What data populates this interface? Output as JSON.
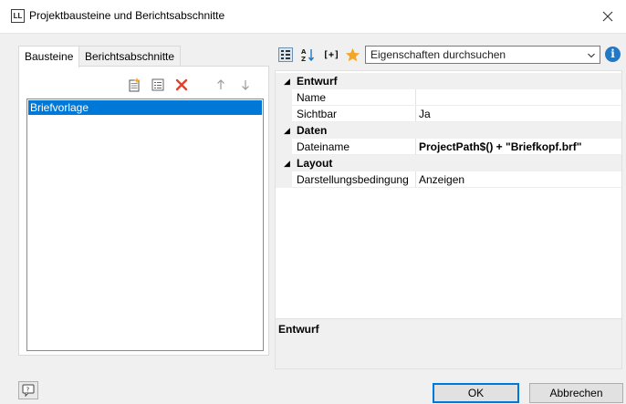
{
  "window": {
    "app_icon_text": "LL",
    "title": "Projektbausteine und Berichtsabschnitte"
  },
  "left": {
    "tabs": [
      {
        "label": "Bausteine",
        "active": true
      },
      {
        "label": "Berichtsabschnitte",
        "active": false
      }
    ],
    "toolbar_icons": [
      "new-item-icon",
      "properties-icon",
      "delete-icon",
      "move-up-icon",
      "move-down-icon"
    ],
    "list_items": [
      {
        "label": "Briefvorlage",
        "selected": true
      }
    ]
  },
  "right": {
    "toolbar_icons": [
      "categorized-view-icon",
      "sort-alphabetical-icon",
      "expand-formula-icon",
      "favorites-star-icon"
    ],
    "expand_label": "[+]",
    "search": {
      "placeholder": "Eigenschaften durchsuchen"
    },
    "info_label": "i",
    "categories": [
      {
        "label": "Entwurf",
        "properties": [
          {
            "name": "Name",
            "value": ""
          },
          {
            "name": "Sichtbar",
            "value": "Ja"
          }
        ]
      },
      {
        "label": "Daten",
        "properties": [
          {
            "name": "Dateiname",
            "value": "ProjectPath$() + \"Briefkopf.brf\"",
            "bold": true
          }
        ]
      },
      {
        "label": "Layout",
        "properties": [
          {
            "name": "Darstellungsbedingung",
            "value": "Anzeigen"
          }
        ]
      }
    ],
    "description_title": "Entwurf"
  },
  "buttons": {
    "ok": "OK",
    "cancel": "Abbrechen"
  },
  "colors": {
    "accent": "#0078d7",
    "delete": "#e43f2c",
    "star": "#f5a623"
  }
}
